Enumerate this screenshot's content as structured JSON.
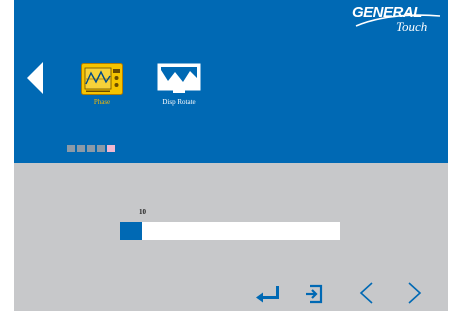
{
  "header": {
    "logo": {
      "brand": "GENERAL",
      "sub": "Touch"
    }
  },
  "menu": {
    "items": [
      {
        "label": "Phase",
        "icon": "phase-waveform-icon",
        "selected": true
      },
      {
        "label": "Disp Rotate",
        "icon": "display-rotate-icon",
        "selected": false
      }
    ],
    "page_indicator": {
      "count": 5,
      "active": 5
    }
  },
  "adjust": {
    "value": "10",
    "level": 0.1
  },
  "controls": [
    {
      "name": "enter",
      "icon": "enter-icon"
    },
    {
      "name": "exit",
      "icon": "exit-icon"
    },
    {
      "name": "previous",
      "icon": "chevron-left-icon"
    },
    {
      "name": "next",
      "icon": "chevron-right-icon"
    }
  ],
  "colors": {
    "top_panel": "#0069b4",
    "bottom_panel": "#c7c8ca",
    "selected_label": "#f5b800",
    "slider_fill": "#0069b4",
    "page_dot": "#8a9aa8",
    "page_dot_active": "#f0b8d0"
  }
}
